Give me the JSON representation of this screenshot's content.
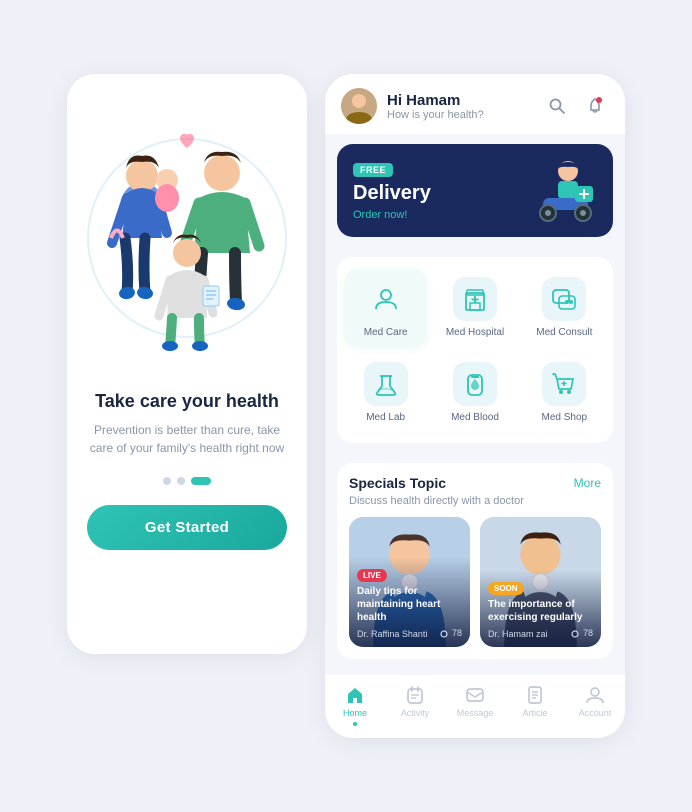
{
  "left": {
    "title": "Take care your health",
    "subtitle": "Prevention is better than cure, take care\nof your family's health right now",
    "dots": [
      "inactive",
      "inactive",
      "active"
    ],
    "button_label": "Get Started"
  },
  "right": {
    "header": {
      "greeting": "Hi Hamam",
      "subtitle": "How is your health?",
      "search_icon": "search",
      "bell_icon": "bell"
    },
    "banner": {
      "free_badge": "FREE",
      "title": "Delivery",
      "subtitle": "Order now!"
    },
    "services": [
      {
        "label": "Med Care",
        "active": true
      },
      {
        "label": "Med Hospital",
        "active": false
      },
      {
        "label": "Med Consult",
        "active": false
      },
      {
        "label": "Med Lab",
        "active": false
      },
      {
        "label": "Med Blood",
        "active": false
      },
      {
        "label": "Med Shop",
        "active": false
      }
    ],
    "specials": {
      "title": "Specials Topic",
      "more": "More",
      "subtitle": "Discuss health directly with a doctor",
      "cards": [
        {
          "badge": "LIVE",
          "badge_type": "live",
          "title": "Daily tips for maintaining heart health",
          "doctor": "Dr. Raffina Shanti",
          "views": "78"
        },
        {
          "badge": "SOON",
          "badge_type": "soon",
          "title": "The importance of exercising regularly",
          "doctor": "Dr. Hamam zai",
          "views": "78"
        }
      ]
    },
    "nav": [
      {
        "icon": "home",
        "label": "Home",
        "active": true
      },
      {
        "icon": "activity",
        "label": "Activity",
        "active": false
      },
      {
        "icon": "message",
        "label": "Message",
        "active": false
      },
      {
        "icon": "article",
        "label": "Article",
        "active": false
      },
      {
        "icon": "account",
        "label": "Account",
        "active": false
      }
    ]
  },
  "colors": {
    "primary": "#2ec4b6",
    "dark_navy": "#1a2a5e",
    "text_dark": "#1a2540",
    "text_muted": "#8a96a8",
    "live_red": "#e63950",
    "soon_orange": "#f5a623"
  }
}
